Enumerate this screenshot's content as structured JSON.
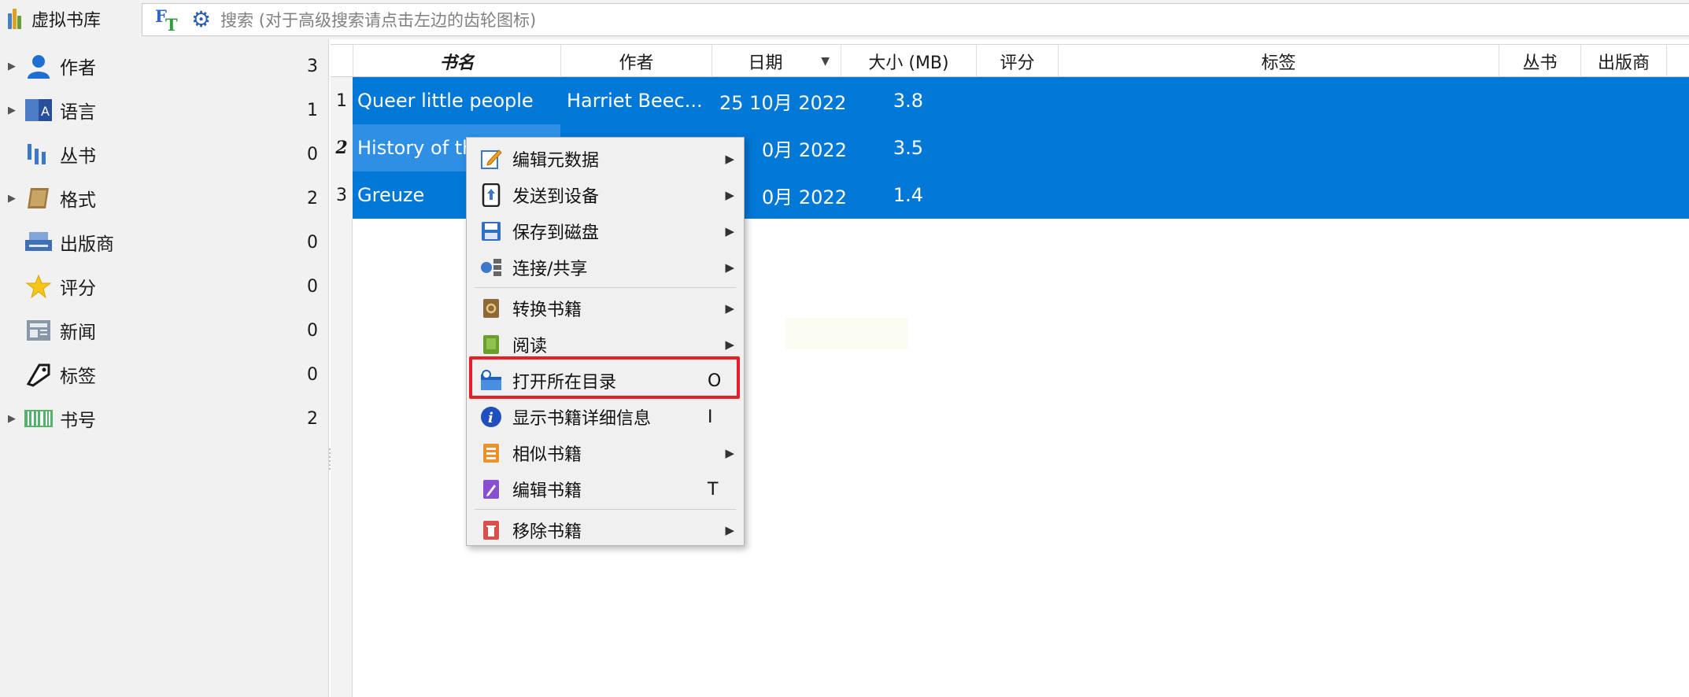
{
  "topbar": {
    "library_label": "虚拟书库",
    "search_placeholder": "搜索 (对于高级搜索请点击左边的齿轮图标)"
  },
  "sidebar": {
    "items": [
      {
        "label": "作者",
        "count": "3",
        "icon": "person-icon",
        "expandable": true
      },
      {
        "label": "语言",
        "count": "1",
        "icon": "language-icon",
        "expandable": true
      },
      {
        "label": "丛书",
        "count": "0",
        "icon": "series-icon",
        "expandable": false
      },
      {
        "label": "格式",
        "count": "2",
        "icon": "format-book-icon",
        "expandable": true
      },
      {
        "label": "出版商",
        "count": "0",
        "icon": "publisher-icon",
        "expandable": false
      },
      {
        "label": "评分",
        "count": "0",
        "icon": "star-icon",
        "expandable": false
      },
      {
        "label": "新闻",
        "count": "0",
        "icon": "news-icon",
        "expandable": false
      },
      {
        "label": "标签",
        "count": "0",
        "icon": "tag-icon",
        "expandable": false
      },
      {
        "label": "书号",
        "count": "2",
        "icon": "barcode-icon",
        "expandable": true
      }
    ]
  },
  "table": {
    "columns": [
      "书名",
      "作者",
      "日期",
      "大小 (MB)",
      "评分",
      "标签",
      "丛书",
      "出版商"
    ],
    "rows": [
      {
        "num": "1",
        "title": "Queer little people",
        "author": "Harriet Beec...",
        "date": "25 10月 2022",
        "size": "3.8"
      },
      {
        "num": "2",
        "title": "History of th",
        "author": "",
        "date": "0月 2022",
        "size": "3.5"
      },
      {
        "num": "3",
        "title": "Greuze",
        "author": "",
        "date": "0月 2022",
        "size": "1.4"
      }
    ]
  },
  "context_menu": {
    "items": [
      {
        "label": "编辑元数据",
        "shortcut": "",
        "submenu": true,
        "icon": "edit-metadata-icon"
      },
      {
        "label": "发送到设备",
        "shortcut": "",
        "submenu": true,
        "icon": "send-to-device-icon"
      },
      {
        "label": "保存到磁盘",
        "shortcut": "",
        "submenu": true,
        "icon": "save-disk-icon"
      },
      {
        "label": "连接/共享",
        "shortcut": "",
        "submenu": true,
        "icon": "connect-share-icon"
      },
      {
        "label": "转换书籍",
        "shortcut": "",
        "submenu": true,
        "icon": "convert-book-icon"
      },
      {
        "label": "阅读",
        "shortcut": "",
        "submenu": true,
        "icon": "read-book-icon"
      },
      {
        "label": "打开所在目录",
        "shortcut": "O",
        "submenu": false,
        "icon": "open-folder-icon"
      },
      {
        "label": "显示书籍详细信息",
        "shortcut": "I",
        "submenu": false,
        "icon": "info-icon"
      },
      {
        "label": "相似书籍",
        "shortcut": "",
        "submenu": true,
        "icon": "similar-books-icon"
      },
      {
        "label": "编辑书籍",
        "shortcut": "T",
        "submenu": false,
        "icon": "edit-book-icon"
      },
      {
        "label": "移除书籍",
        "shortcut": "",
        "submenu": true,
        "icon": "remove-book-icon"
      }
    ]
  },
  "colors": {
    "selection": "#0078d7",
    "highlight_box": "#e5202a",
    "sidebar_bg": "#f1f1f1"
  }
}
